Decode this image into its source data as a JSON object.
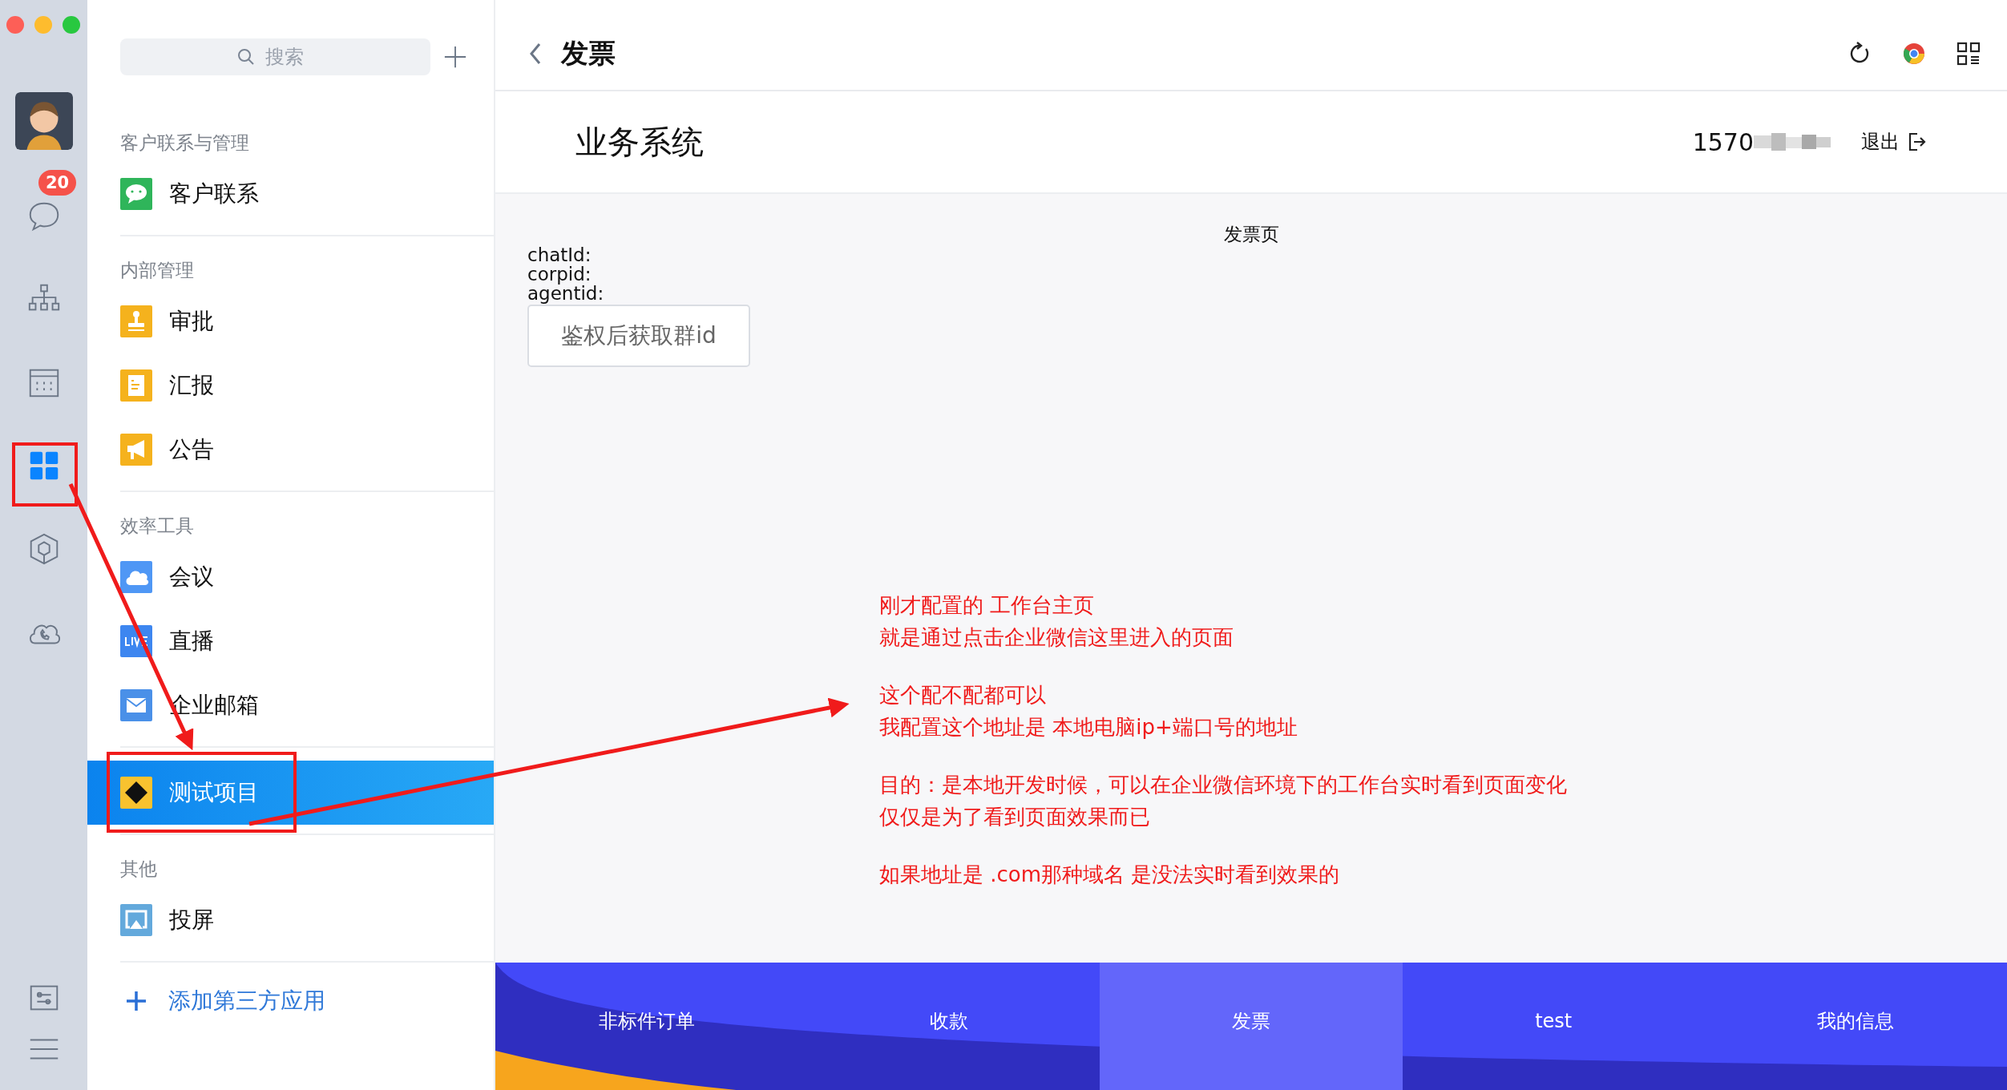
{
  "rail": {
    "top_items": [
      {
        "kind": "avatar",
        "selected": false
      },
      {
        "kind": "chat",
        "selected": false,
        "badge": "20"
      },
      {
        "kind": "org",
        "selected": false
      },
      {
        "kind": "calendar",
        "selected": false
      },
      {
        "kind": "apps",
        "selected": true
      },
      {
        "kind": "cube",
        "selected": false
      },
      {
        "kind": "cloud",
        "selected": false
      }
    ],
    "bottom_items": [
      {
        "kind": "sliders",
        "selected": false
      },
      {
        "kind": "menu",
        "selected": false
      }
    ]
  },
  "sidebar": {
    "search": {
      "placeholder": "搜索"
    },
    "sections": [
      {
        "title": "客户联系与管理",
        "items": [
          {
            "label": "客户联系",
            "kind": "chat",
            "selected": false
          }
        ]
      },
      {
        "title": "内部管理",
        "items": [
          {
            "label": "审批",
            "kind": "stamp",
            "selected": false
          },
          {
            "label": "汇报",
            "kind": "report",
            "selected": false
          },
          {
            "label": "公告",
            "kind": "megaphone",
            "selected": false
          }
        ]
      },
      {
        "title": "效率工具",
        "items": [
          {
            "label": "会议",
            "kind": "meeting",
            "selected": false
          },
          {
            "label": "直播",
            "kind": "live",
            "selected": false
          },
          {
            "label": "企业邮箱",
            "kind": "mail",
            "selected": false
          }
        ]
      },
      {
        "items": [
          {
            "label": "测试项目",
            "kind": "diamond",
            "selected": true
          }
        ]
      },
      {
        "title": "其他",
        "items": [
          {
            "label": "投屏",
            "kind": "screen",
            "selected": false
          }
        ]
      }
    ],
    "add_link": "添加第三方应用"
  },
  "header": {
    "title": "发票"
  },
  "subheader": {
    "title": "业务系统",
    "phone": "1570",
    "logout": "退出"
  },
  "page": {
    "heading": "发票页",
    "fields": [
      "chatId:",
      "corpid:",
      "agentid:"
    ],
    "button": "鉴权后获取群id"
  },
  "notes": [
    [
      "刚才配置的 工作台主页",
      "就是通过点击企业微信这里进入的页面"
    ],
    [
      "这个配不配都可以",
      "我配置这个地址是 本地电脑ip+端口号的地址"
    ],
    [
      "目的：是本地开发时候，可以在企业微信环境下的工作台实时看到页面变化",
      "仅仅是为了看到页面效果而已"
    ],
    [
      "如果地址是 .com那种域名 是没法实时看到效果的"
    ]
  ],
  "tabbar": [
    {
      "label": "非标件订单",
      "selected": false
    },
    {
      "label": "收款",
      "selected": false
    },
    {
      "label": "发票",
      "selected": true
    },
    {
      "label": "test",
      "selected": false
    },
    {
      "label": "我的信息",
      "selected": false
    }
  ]
}
